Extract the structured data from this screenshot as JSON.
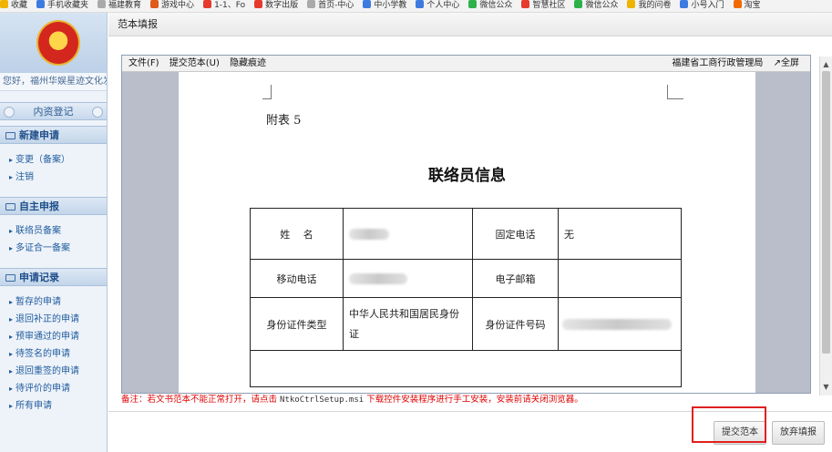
{
  "bookmarks": [
    {
      "label": "收藏",
      "color": "#f0b400"
    },
    {
      "label": "手机收藏夹",
      "color": "#3d7be0"
    },
    {
      "label": "福建教育",
      "color": "#aaaaaa"
    },
    {
      "label": "游戏中心",
      "color": "#e05a1a"
    },
    {
      "label": "1-1、Fo",
      "color": "#e63a2e"
    },
    {
      "label": "数字出版",
      "color": "#e63a2e"
    },
    {
      "label": "首页-中心",
      "color": "#aaaaaa"
    },
    {
      "label": "中小学教",
      "color": "#3d7be0"
    },
    {
      "label": "个人中心",
      "color": "#3d7be0"
    },
    {
      "label": "微信公众",
      "color": "#2db24a"
    },
    {
      "label": "智慧社区",
      "color": "#e63a2e"
    },
    {
      "label": "微信公众",
      "color": "#2db24a"
    },
    {
      "label": "我的问卷",
      "color": "#f0b400"
    },
    {
      "label": "小号入门",
      "color": "#3d7be0"
    },
    {
      "label": "淘宝",
      "color": "#f06a00"
    }
  ],
  "sidebar": {
    "greeting": "您好，福州华娱星迹文化发展",
    "tab_label": "内资登记",
    "sections": [
      {
        "title": "新建申请",
        "items": [
          "变更（备案）",
          "注销"
        ]
      },
      {
        "title": "自主申报",
        "items": [
          "联络员备案",
          "多证合一备案"
        ]
      },
      {
        "title": "申请记录",
        "items": [
          "暂存的申请",
          "退回补正的申请",
          "预审通过的申请",
          "待签名的申请",
          "退回重签的申请",
          "待评价的申请",
          "所有申请"
        ]
      }
    ]
  },
  "main": {
    "title": "范本填报",
    "menu": {
      "file": "文件(F)",
      "submit": "提交范本(U)",
      "hide_marks": "隐藏痕迹",
      "org": "福建省工商行政管理局",
      "fullscreen": "↗全屏"
    },
    "document": {
      "appendix": "附表 5",
      "title": "联络员信息",
      "rows": [
        {
          "l1": "姓　 名",
          "v1": "",
          "l2": "固定电话",
          "v2": "无"
        },
        {
          "l1": "移动电话",
          "v1": "",
          "l2": "电子邮箱",
          "v2": ""
        },
        {
          "l1": "身份证件类型",
          "v1": "中华人民共和国居民身份证",
          "l2": "身份证件号码",
          "v2": ""
        }
      ]
    },
    "notice": {
      "prefix": "备注：若文书范本不能正常打开，请点击",
      "file": "NtkoCtrlSetup.msi",
      "suffix": "下载控件安装程序进行手工安装，安装前请关闭浏览器。"
    },
    "buttons": {
      "submit": "提交范本",
      "give_up": "放弃填报"
    }
  },
  "colors": {
    "accent_blue": "#1f5b9e",
    "notice_red": "#e00000",
    "highlight_red": "#e02020"
  }
}
